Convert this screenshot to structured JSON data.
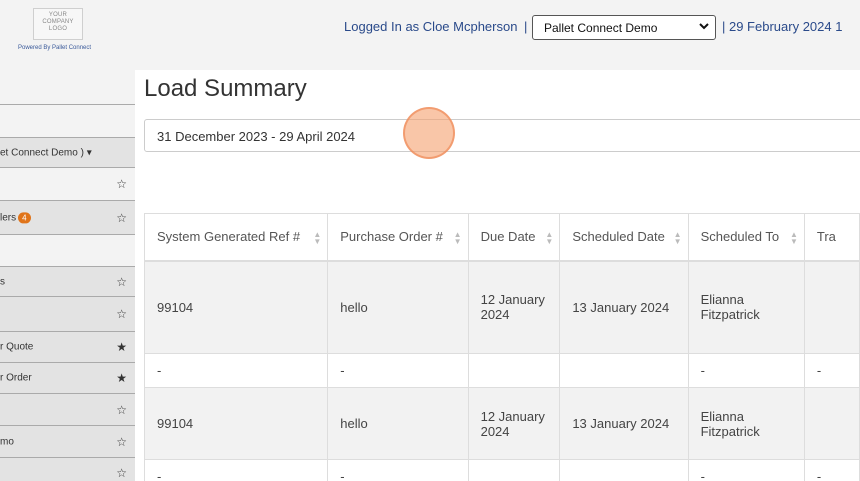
{
  "header": {
    "logo_text": [
      "YOUR",
      "COMPANY",
      "LOGO"
    ],
    "powered_by": "Powered By Pallet Connect",
    "logged_in": "Logged In as Cloe Mcpherson",
    "pipe": "|",
    "company_select": "Pallet Connect Demo",
    "date": "| 29 February 2024 1"
  },
  "sidebar": {
    "items": [
      {
        "label": "et Connect Demo )",
        "suffix": "▾",
        "star": ""
      },
      {
        "label": "",
        "star": "☆"
      },
      {
        "label": "lers",
        "badge": "4",
        "star": "☆"
      },
      {
        "label": "",
        "star": ""
      },
      {
        "label": "s",
        "star": "☆"
      },
      {
        "label": "",
        "star": "☆"
      },
      {
        "label": "r Quote",
        "star": "★"
      },
      {
        "label": "r Order",
        "star": "★"
      },
      {
        "label": "",
        "star": "☆"
      },
      {
        "label": "mo",
        "star": "☆"
      },
      {
        "label": "",
        "star": "☆"
      }
    ]
  },
  "main": {
    "title": "Load Summary",
    "date_range": "31 December 2023 - 29 April 2024",
    "columns": [
      "System Generated Ref #",
      "Purchase Order #",
      "Due Date",
      "Scheduled Date",
      "Scheduled To",
      "Tra"
    ],
    "rows": [
      [
        "99104",
        "hello",
        "12 January 2024",
        "13 January 2024",
        "Elianna Fitzpatrick",
        ""
      ],
      [
        "-",
        "-",
        "",
        "",
        "-",
        "-"
      ],
      [
        "99104",
        "hello",
        "12 January 2024",
        "13 January 2024",
        "Elianna Fitzpatrick",
        ""
      ],
      [
        "-",
        "-",
        "",
        "",
        "-",
        "-"
      ]
    ]
  }
}
